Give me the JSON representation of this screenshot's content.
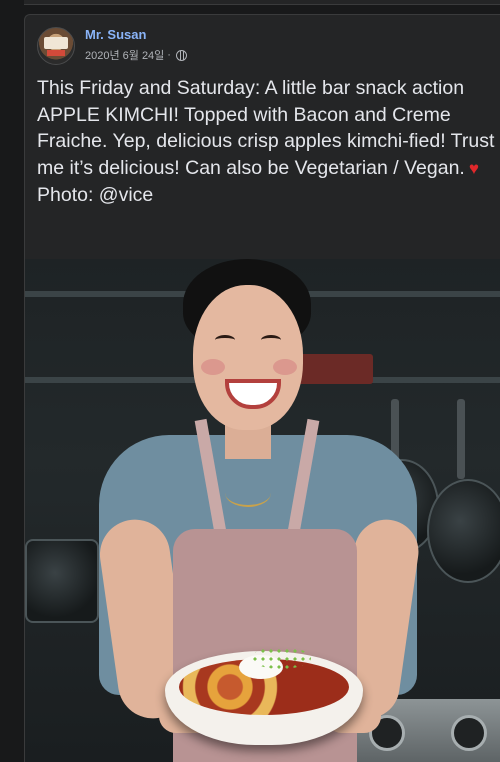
{
  "post": {
    "author": "Mr. Susan",
    "date": "2020년 6월 24일",
    "separator": "·",
    "privacy_icon": "globe-icon",
    "text_lines": [
      "This Friday and Saturday: A little bar snack action APPLE KIMCHI! Topped with Bacon and Creme Fraiche. Yep, delicious crisp apples kimchi-fied! Trust me it’s delicious! Can also be Vegetarian / Vegan.",
      "Photo: @vice"
    ],
    "heart": "♥",
    "heart_icon": "heart-icon"
  },
  "colors": {
    "background": "#18191a",
    "card": "#242526",
    "author_link": "#8ab4f8",
    "text": "#e4e6eb",
    "heart": "#e0282b"
  }
}
